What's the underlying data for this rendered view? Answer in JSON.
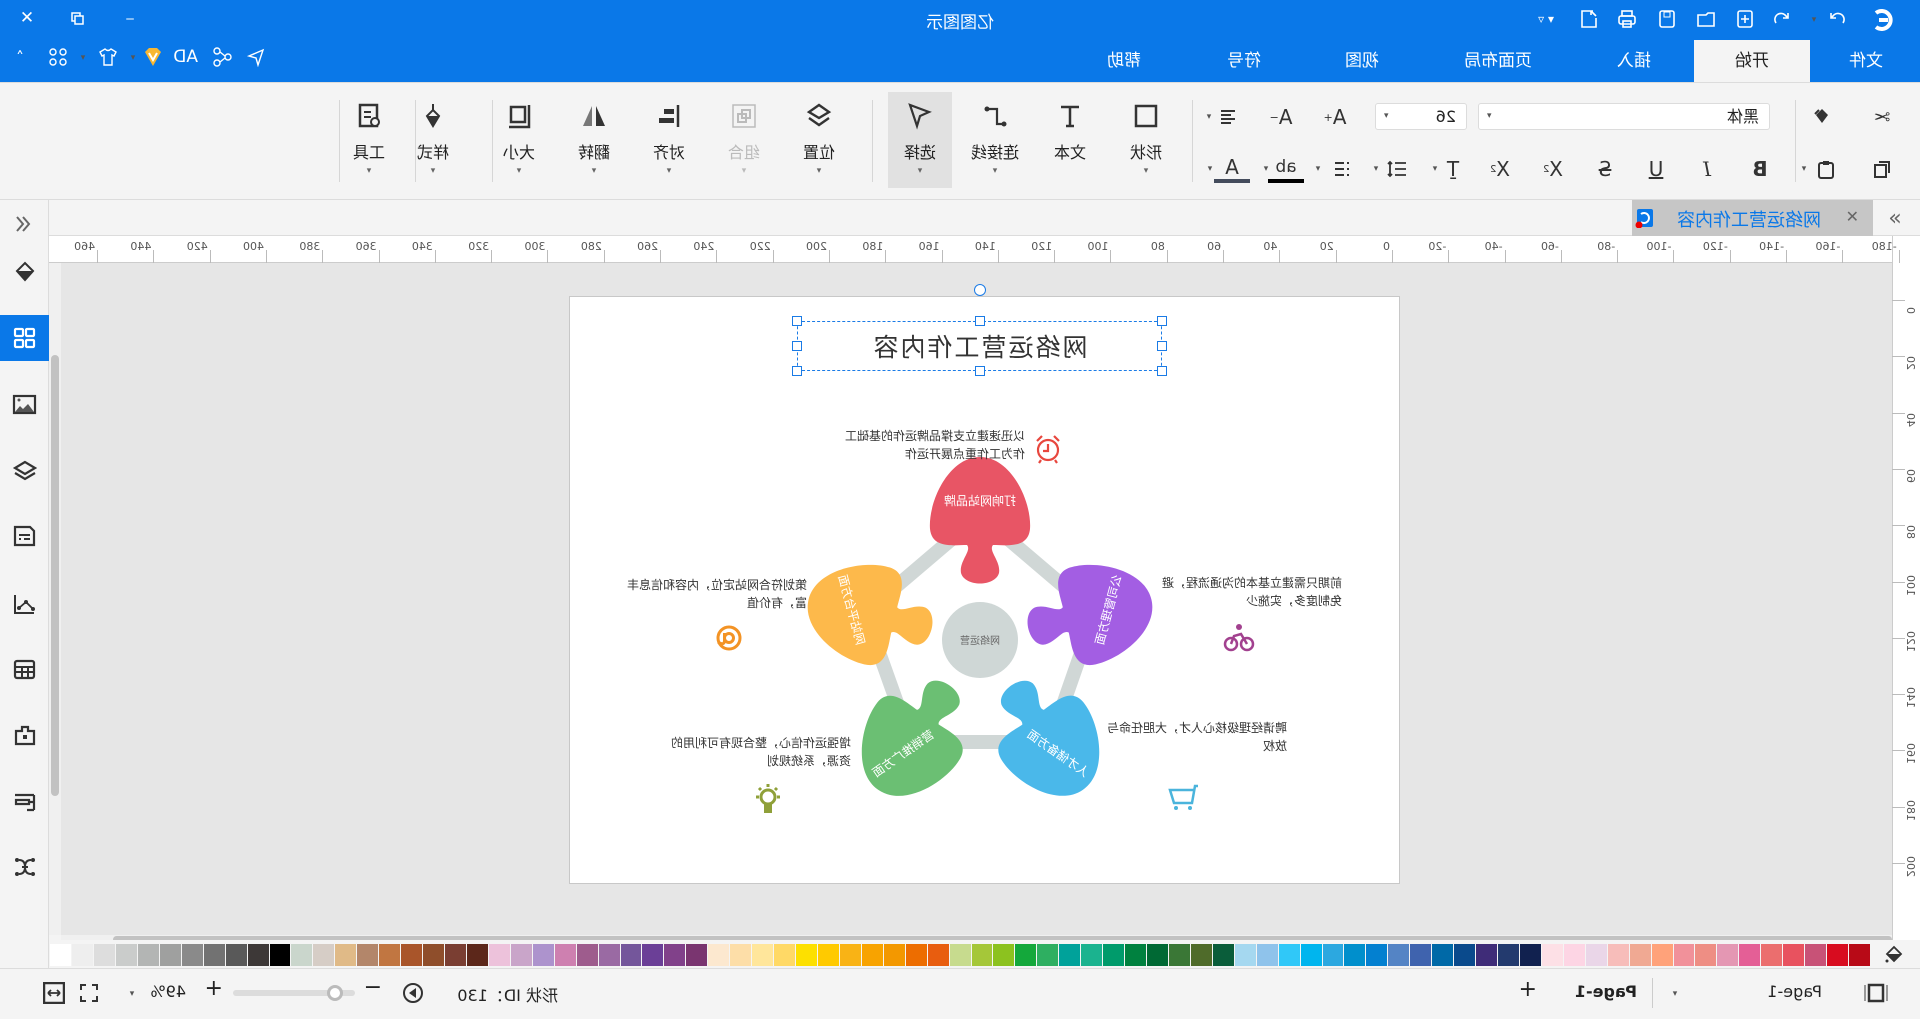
{
  "app": {
    "title": "亿图图示"
  },
  "quick_access": [
    "logo-icon",
    "redo-icon",
    "undo-icon",
    "new-icon",
    "open-icon",
    "save-icon",
    "print-icon",
    "export-icon",
    "more-icon"
  ],
  "window_controls": [
    "minimize-icon",
    "restore-icon",
    "close-icon"
  ],
  "tabs": [
    {
      "label": "文件"
    },
    {
      "label": "开始",
      "active": true
    },
    {
      "label": "插入"
    },
    {
      "label": "页面布局"
    },
    {
      "label": "视图"
    },
    {
      "label": "符号"
    },
    {
      "label": "帮助"
    }
  ],
  "ribbon_right": {
    "ad_label": "AD"
  },
  "toolbar": {
    "font_name": "黑体",
    "font_size": "26",
    "buttons": [
      {
        "label": "形状"
      },
      {
        "label": "文本"
      },
      {
        "label": "连接线"
      },
      {
        "label": "选择",
        "active": true
      },
      {
        "label": "位置"
      },
      {
        "label": "组合",
        "disabled": true
      },
      {
        "label": "对齐"
      },
      {
        "label": "翻转"
      },
      {
        "label": "大小"
      },
      {
        "label": "样式"
      },
      {
        "label": "工具"
      }
    ],
    "format": {
      "bold": "B",
      "italic": "I",
      "underline": "U",
      "strike": "S"
    }
  },
  "document_tab": {
    "title": "网络运营工作内容"
  },
  "ruler": {
    "h_labels": [
      "-180",
      "-160",
      "-140",
      "-120",
      "-100",
      "-80",
      "-60",
      "-40",
      "-20",
      "0",
      "20",
      "40",
      "60",
      "80",
      "100",
      "120",
      "140",
      "160",
      "180",
      "200",
      "220",
      "240",
      "260",
      "280",
      "300",
      "320",
      "340",
      "360",
      "380",
      "400",
      "420",
      "440",
      "460"
    ],
    "v_labels": [
      "0",
      "20",
      "40",
      "60",
      "80",
      "100",
      "120",
      "140",
      "160",
      "180",
      "200"
    ]
  },
  "diagram": {
    "title": "网络运营工作内容",
    "center": "网络运营",
    "pieces": [
      {
        "label": "打响网站品牌",
        "color": "#e85565",
        "desc": "以迅速建立支撑品牌运作的基础工作为工作重点展开运作",
        "icon": "alarm-clock-icon",
        "icon_color": "#e8473e"
      },
      {
        "label": "网站平台方面",
        "color": "#fdb94b",
        "desc": "策划符合网站定位，内容和信息丰富，有价值",
        "icon": "at-sign-icon",
        "icon_color": "#f39325"
      },
      {
        "label": "营销推广方面",
        "color": "#6bbf73",
        "desc": "增强运作信心，整合现有可利用的资源，系统规划",
        "icon": "lightbulb-icon",
        "icon_color": "#8fa039"
      },
      {
        "label": "人才储备方面",
        "color": "#4ab8ea",
        "desc": "聘请经理级核心人才，大胆任命与放权",
        "icon": "shopping-cart-icon",
        "icon_color": "#4ab4dc"
      },
      {
        "label": "公司管理方面",
        "color": "#a35ee3",
        "desc": "前期只需建立基本的沟通流程，避免制度多，实施少",
        "icon": "bicycle-icon",
        "icon_color": "#a2418f"
      }
    ]
  },
  "palette": [
    "#b80a17",
    "#d80c1f",
    "#c85277",
    "#e8525f",
    "#eb6e6e",
    "#e45f96",
    "#e497b3",
    "#ee8e84",
    "#f1919a",
    "#ffa27a",
    "#f0a993",
    "#f7bdba",
    "#ead6e8",
    "#fdd5e4",
    "#fde0e6",
    "#11214f",
    "#233a6e",
    "#3f2c78",
    "#0a4a8c",
    "#0069a7",
    "#3f63ae",
    "#5484c5",
    "#0380d0",
    "#008fcc",
    "#2ca8e0",
    "#00b5ee",
    "#30c8f8",
    "#8fc3eb",
    "#a5d8f0",
    "#0a5d3a",
    "#4f6b2a",
    "#3a7736",
    "#006934",
    "#00813f",
    "#009b6b",
    "#1bb38f",
    "#00a29a",
    "#2eaf61",
    "#14a83b",
    "#8cc21f",
    "#a5c739",
    "#c7db8e",
    "#e85d0f",
    "#ed6d00",
    "#f39800",
    "#f8a300",
    "#f9b315",
    "#ffca00",
    "#fde000",
    "#ffd966",
    "#ffe69b",
    "#fddea8",
    "#fce8cf",
    "#7a3570",
    "#81418a",
    "#6b3f97",
    "#74569b",
    "#9a6aa3",
    "#9e5c8d",
    "#ce80b0",
    "#ad93cd",
    "#c9a5c9",
    "#edc2db",
    "#5c271a",
    "#7a3e32",
    "#8f4e2b",
    "#a9552a",
    "#c17641",
    "#b3866a",
    "#e0ba87",
    "#d6cdc6",
    "#cad6cc",
    "#000000",
    "#3d3837",
    "#595959",
    "#727272",
    "#8a8a8a",
    "#9fa09f",
    "#b3b5b4",
    "#cacccb",
    "#dddddd",
    "#eeeeee",
    "#ffffff"
  ],
  "status": {
    "page_label": "Page-1",
    "page_tab": "Page-1",
    "shape_id": "形状 ID：130",
    "zoom": "49%",
    "zoom_fraction": 0.1
  },
  "colors": {
    "accent": "#0a78e8"
  }
}
